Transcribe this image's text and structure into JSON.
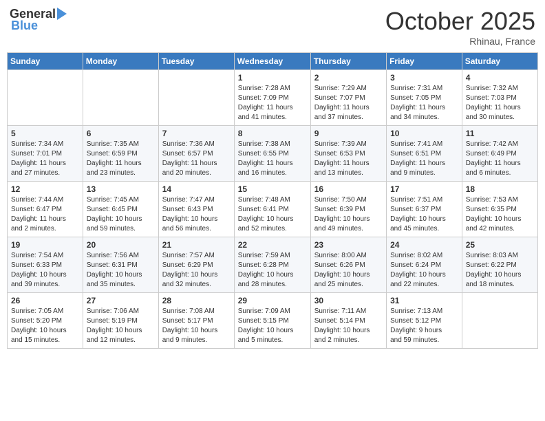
{
  "header": {
    "logo_general": "General",
    "logo_blue": "Blue",
    "month_title": "October 2025",
    "location": "Rhinau, France"
  },
  "weekdays": [
    "Sunday",
    "Monday",
    "Tuesday",
    "Wednesday",
    "Thursday",
    "Friday",
    "Saturday"
  ],
  "weeks": [
    [
      {
        "day": "",
        "info": ""
      },
      {
        "day": "",
        "info": ""
      },
      {
        "day": "",
        "info": ""
      },
      {
        "day": "1",
        "info": "Sunrise: 7:28 AM\nSunset: 7:09 PM\nDaylight: 11 hours\nand 41 minutes."
      },
      {
        "day": "2",
        "info": "Sunrise: 7:29 AM\nSunset: 7:07 PM\nDaylight: 11 hours\nand 37 minutes."
      },
      {
        "day": "3",
        "info": "Sunrise: 7:31 AM\nSunset: 7:05 PM\nDaylight: 11 hours\nand 34 minutes."
      },
      {
        "day": "4",
        "info": "Sunrise: 7:32 AM\nSunset: 7:03 PM\nDaylight: 11 hours\nand 30 minutes."
      }
    ],
    [
      {
        "day": "5",
        "info": "Sunrise: 7:34 AM\nSunset: 7:01 PM\nDaylight: 11 hours\nand 27 minutes."
      },
      {
        "day": "6",
        "info": "Sunrise: 7:35 AM\nSunset: 6:59 PM\nDaylight: 11 hours\nand 23 minutes."
      },
      {
        "day": "7",
        "info": "Sunrise: 7:36 AM\nSunset: 6:57 PM\nDaylight: 11 hours\nand 20 minutes."
      },
      {
        "day": "8",
        "info": "Sunrise: 7:38 AM\nSunset: 6:55 PM\nDaylight: 11 hours\nand 16 minutes."
      },
      {
        "day": "9",
        "info": "Sunrise: 7:39 AM\nSunset: 6:53 PM\nDaylight: 11 hours\nand 13 minutes."
      },
      {
        "day": "10",
        "info": "Sunrise: 7:41 AM\nSunset: 6:51 PM\nDaylight: 11 hours\nand 9 minutes."
      },
      {
        "day": "11",
        "info": "Sunrise: 7:42 AM\nSunset: 6:49 PM\nDaylight: 11 hours\nand 6 minutes."
      }
    ],
    [
      {
        "day": "12",
        "info": "Sunrise: 7:44 AM\nSunset: 6:47 PM\nDaylight: 11 hours\nand 2 minutes."
      },
      {
        "day": "13",
        "info": "Sunrise: 7:45 AM\nSunset: 6:45 PM\nDaylight: 10 hours\nand 59 minutes."
      },
      {
        "day": "14",
        "info": "Sunrise: 7:47 AM\nSunset: 6:43 PM\nDaylight: 10 hours\nand 56 minutes."
      },
      {
        "day": "15",
        "info": "Sunrise: 7:48 AM\nSunset: 6:41 PM\nDaylight: 10 hours\nand 52 minutes."
      },
      {
        "day": "16",
        "info": "Sunrise: 7:50 AM\nSunset: 6:39 PM\nDaylight: 10 hours\nand 49 minutes."
      },
      {
        "day": "17",
        "info": "Sunrise: 7:51 AM\nSunset: 6:37 PM\nDaylight: 10 hours\nand 45 minutes."
      },
      {
        "day": "18",
        "info": "Sunrise: 7:53 AM\nSunset: 6:35 PM\nDaylight: 10 hours\nand 42 minutes."
      }
    ],
    [
      {
        "day": "19",
        "info": "Sunrise: 7:54 AM\nSunset: 6:33 PM\nDaylight: 10 hours\nand 39 minutes."
      },
      {
        "day": "20",
        "info": "Sunrise: 7:56 AM\nSunset: 6:31 PM\nDaylight: 10 hours\nand 35 minutes."
      },
      {
        "day": "21",
        "info": "Sunrise: 7:57 AM\nSunset: 6:29 PM\nDaylight: 10 hours\nand 32 minutes."
      },
      {
        "day": "22",
        "info": "Sunrise: 7:59 AM\nSunset: 6:28 PM\nDaylight: 10 hours\nand 28 minutes."
      },
      {
        "day": "23",
        "info": "Sunrise: 8:00 AM\nSunset: 6:26 PM\nDaylight: 10 hours\nand 25 minutes."
      },
      {
        "day": "24",
        "info": "Sunrise: 8:02 AM\nSunset: 6:24 PM\nDaylight: 10 hours\nand 22 minutes."
      },
      {
        "day": "25",
        "info": "Sunrise: 8:03 AM\nSunset: 6:22 PM\nDaylight: 10 hours\nand 18 minutes."
      }
    ],
    [
      {
        "day": "26",
        "info": "Sunrise: 7:05 AM\nSunset: 5:20 PM\nDaylight: 10 hours\nand 15 minutes."
      },
      {
        "day": "27",
        "info": "Sunrise: 7:06 AM\nSunset: 5:19 PM\nDaylight: 10 hours\nand 12 minutes."
      },
      {
        "day": "28",
        "info": "Sunrise: 7:08 AM\nSunset: 5:17 PM\nDaylight: 10 hours\nand 9 minutes."
      },
      {
        "day": "29",
        "info": "Sunrise: 7:09 AM\nSunset: 5:15 PM\nDaylight: 10 hours\nand 5 minutes."
      },
      {
        "day": "30",
        "info": "Sunrise: 7:11 AM\nSunset: 5:14 PM\nDaylight: 10 hours\nand 2 minutes."
      },
      {
        "day": "31",
        "info": "Sunrise: 7:13 AM\nSunset: 5:12 PM\nDaylight: 9 hours\nand 59 minutes."
      },
      {
        "day": "",
        "info": ""
      }
    ]
  ]
}
